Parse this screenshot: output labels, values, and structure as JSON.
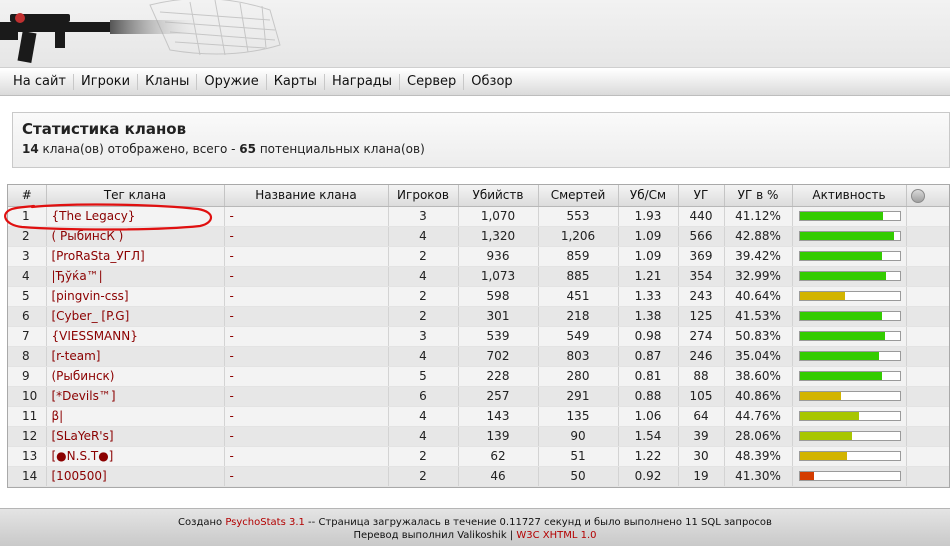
{
  "nav": {
    "items": [
      "На сайт",
      "Игроки",
      "Кланы",
      "Оружие",
      "Карты",
      "Награды",
      "Сервер",
      "Обзор"
    ]
  },
  "title": {
    "heading": "Статистика кланов",
    "shown_count": "14",
    "summary_mid": " клана(ов) отображено, всего - ",
    "total_count": "65",
    "summary_end": " потенциальных клана(ов)"
  },
  "table": {
    "headers": [
      "#",
      "Тег клана",
      "Название клана",
      "Игроков",
      "Убийств",
      "Смертей",
      "Уб/См",
      "УГ",
      "УГ в %",
      "Активность"
    ],
    "rows": [
      {
        "rank": "1",
        "tag": "{The Legacy}",
        "name": "-",
        "players": "3",
        "kills": "1,070",
        "deaths": "553",
        "kd": "1.93",
        "hs": "440",
        "hsp": "41.12%",
        "activity": 0.83
      },
      {
        "rank": "2",
        "tag": "( РыбинсК )",
        "name": "-",
        "players": "4",
        "kills": "1,320",
        "deaths": "1,206",
        "kd": "1.09",
        "hs": "566",
        "hsp": "42.88%",
        "activity": 0.94
      },
      {
        "rank": "3",
        "tag": "[ProRaSta_УГЛ]",
        "name": "-",
        "players": "2",
        "kills": "936",
        "deaths": "859",
        "kd": "1.09",
        "hs": "369",
        "hsp": "39.42%",
        "activity": 0.82
      },
      {
        "rank": "4",
        "tag": "|Ђўќа™|",
        "name": "-",
        "players": "4",
        "kills": "1,073",
        "deaths": "885",
        "kd": "1.21",
        "hs": "354",
        "hsp": "32.99%",
        "activity": 0.86
      },
      {
        "rank": "5",
        "tag": "[pingvin-css]",
        "name": "-",
        "players": "2",
        "kills": "598",
        "deaths": "451",
        "kd": "1.33",
        "hs": "243",
        "hsp": "40.64%",
        "activity": 0.45
      },
      {
        "rank": "6",
        "tag": "[Cyber_ [P.G]",
        "name": "-",
        "players": "2",
        "kills": "301",
        "deaths": "218",
        "kd": "1.38",
        "hs": "125",
        "hsp": "41.53%",
        "activity": 0.82
      },
      {
        "rank": "7",
        "tag": "{VIESSMANN}",
        "name": "-",
        "players": "3",
        "kills": "539",
        "deaths": "549",
        "kd": "0.98",
        "hs": "274",
        "hsp": "50.83%",
        "activity": 0.85
      },
      {
        "rank": "8",
        "tag": "[r-team]",
        "name": "-",
        "players": "4",
        "kills": "702",
        "deaths": "803",
        "kd": "0.87",
        "hs": "246",
        "hsp": "35.04%",
        "activity": 0.79
      },
      {
        "rank": "9",
        "tag": "(Рыбинск)",
        "name": "-",
        "players": "5",
        "kills": "228",
        "deaths": "280",
        "kd": "0.81",
        "hs": "88",
        "hsp": "38.60%",
        "activity": 0.82
      },
      {
        "rank": "10",
        "tag": "[*Devils™]",
        "name": "-",
        "players": "6",
        "kills": "257",
        "deaths": "291",
        "kd": "0.88",
        "hs": "105",
        "hsp": "40.86%",
        "activity": 0.41
      },
      {
        "rank": "11",
        "tag": "β|",
        "name": "-",
        "players": "4",
        "kills": "143",
        "deaths": "135",
        "kd": "1.06",
        "hs": "64",
        "hsp": "44.76%",
        "activity": 0.59
      },
      {
        "rank": "12",
        "tag": "[SLaYeR's]",
        "name": "-",
        "players": "4",
        "kills": "139",
        "deaths": "90",
        "kd": "1.54",
        "hs": "39",
        "hsp": "28.06%",
        "activity": 0.52
      },
      {
        "rank": "13",
        "tag": "[●N.S.T●]",
        "name": "-",
        "players": "2",
        "kills": "62",
        "deaths": "51",
        "kd": "1.22",
        "hs": "30",
        "hsp": "48.39%",
        "activity": 0.47
      },
      {
        "rank": "14",
        "tag": "[100500]",
        "name": "-",
        "players": "2",
        "kills": "46",
        "deaths": "50",
        "kd": "0.92",
        "hs": "19",
        "hsp": "41.30%",
        "activity": 0.14
      }
    ]
  },
  "colors": {
    "high": "#33cc00",
    "mid": "#a8c600",
    "medium": "#d2b400",
    "low": "#d43c00",
    "annotation": "#e01010"
  },
  "footer": {
    "created": "Создано ",
    "app_link": "PsychoStats 3.1",
    "line1_rest": " -- Страница загружалась в течение 0.11727 секунд и было выполнено 11 SQL запросов",
    "line2_text": "Перевод выполнил Valikoshik | ",
    "w3c_link": "W3C XHTML 1.0"
  }
}
